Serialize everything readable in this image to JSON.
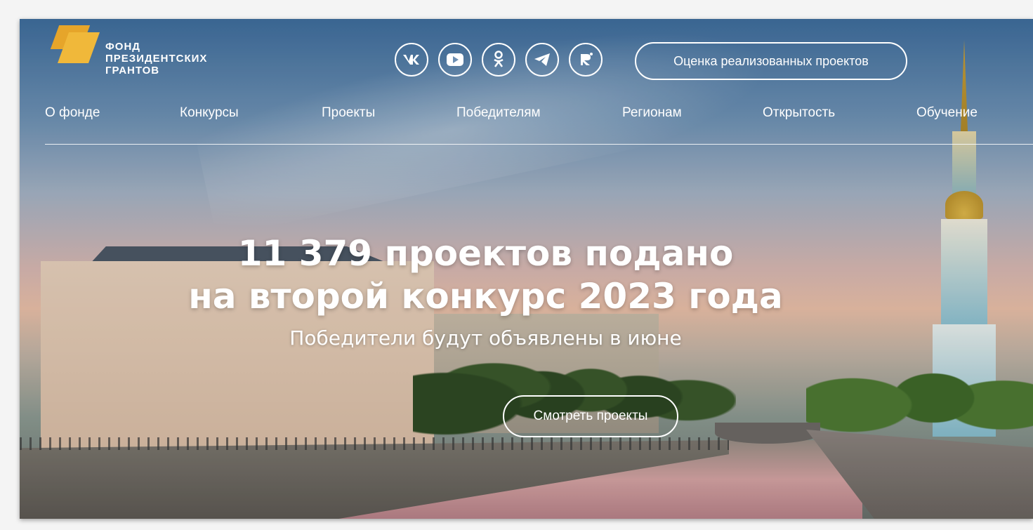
{
  "logo": {
    "line1": "ФОНД",
    "line2": "ПРЕЗИДЕНТСКИХ",
    "line3": "ГРАНТОВ"
  },
  "socials": [
    {
      "icon": "vk-icon",
      "glyph": "VK"
    },
    {
      "icon": "youtube-icon",
      "glyph": "▶"
    },
    {
      "icon": "odnoklassniki-icon",
      "glyph": "ok"
    },
    {
      "icon": "telegram-icon",
      "glyph": "➤"
    },
    {
      "icon": "rutube-icon",
      "glyph": "R"
    }
  ],
  "header": {
    "evaluation_button": "Оценка реализованных проектов"
  },
  "nav": {
    "items": [
      "О фонде",
      "Конкурсы",
      "Проекты",
      "Победителям",
      "Регионам",
      "Открытость",
      "Обучение"
    ]
  },
  "hero": {
    "title_line1": "11 379 проектов подано",
    "title_line2": "на второй конкурс 2023 года",
    "subtitle": "Победители будут объявлены в июне",
    "cta": "Смотреть проекты"
  },
  "colors": {
    "logo_accent": "#f0b83a",
    "text": "#ffffff"
  }
}
